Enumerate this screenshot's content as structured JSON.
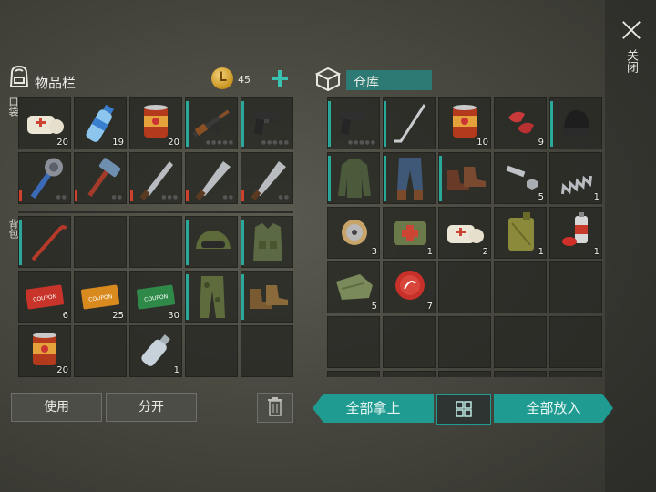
{
  "close": {
    "label": "关闭"
  },
  "inventory": {
    "title": "物品栏",
    "coins": "45",
    "pocket_label": "口袋",
    "backpack_label": "背包",
    "pocket_slots": [
      {
        "icon": "bandage-icon",
        "qty": "20"
      },
      {
        "icon": "water-bottle-icon",
        "qty": "19"
      },
      {
        "icon": "canned-food-icon",
        "qty": "20"
      },
      {
        "icon": "rifle-icon",
        "qty": ""
      },
      {
        "icon": "pistol-icon",
        "qty": ""
      },
      {
        "icon": "spiked-club-icon",
        "qty": ""
      },
      {
        "icon": "hammer-icon",
        "qty": ""
      },
      {
        "icon": "machete-icon",
        "qty": ""
      },
      {
        "icon": "machete-icon",
        "qty": ""
      },
      {
        "icon": "machete-icon",
        "qty": ""
      }
    ],
    "backpack_slots": [
      {
        "icon": "crowbar-icon",
        "qty": ""
      },
      {
        "icon": "empty",
        "qty": ""
      },
      {
        "icon": "empty",
        "qty": ""
      },
      {
        "icon": "helmet-icon",
        "qty": ""
      },
      {
        "icon": "vest-icon",
        "qty": ""
      },
      {
        "icon": "coupon-red-icon",
        "qty": "6"
      },
      {
        "icon": "coupon-orange-icon",
        "qty": "25"
      },
      {
        "icon": "coupon-green-icon",
        "qty": "30"
      },
      {
        "icon": "camo-pants-icon",
        "qty": ""
      },
      {
        "icon": "boots-icon",
        "qty": ""
      },
      {
        "icon": "canned-food-icon",
        "qty": "20"
      },
      {
        "icon": "empty",
        "qty": ""
      },
      {
        "icon": "bottle-icon",
        "qty": "1"
      },
      {
        "icon": "empty",
        "qty": ""
      },
      {
        "icon": "empty",
        "qty": ""
      }
    ],
    "use_button": "使用",
    "split_button": "分开"
  },
  "storage": {
    "title": "仓库",
    "slots": [
      {
        "icon": "pistol-icon",
        "qty": ""
      },
      {
        "icon": "hockey-stick-icon",
        "qty": ""
      },
      {
        "icon": "canned-food-icon",
        "qty": "10"
      },
      {
        "icon": "meat-icon",
        "qty": "9"
      },
      {
        "icon": "beanie-icon",
        "qty": ""
      },
      {
        "icon": "jacket-icon",
        "qty": ""
      },
      {
        "icon": "jeans-icon",
        "qty": ""
      },
      {
        "icon": "boots-icon",
        "qty": ""
      },
      {
        "icon": "bolt-nut-icon",
        "qty": "5"
      },
      {
        "icon": "spring-icon",
        "qty": "1"
      },
      {
        "icon": "wire-spool-icon",
        "qty": "3"
      },
      {
        "icon": "medkit-bag-icon",
        "qty": "1"
      },
      {
        "icon": "bandage-icon",
        "qty": "2"
      },
      {
        "icon": "jerrycan-icon",
        "qty": "1"
      },
      {
        "icon": "spray-can-icon",
        "qty": "1"
      },
      {
        "icon": "cloth-icon",
        "qty": "5"
      },
      {
        "icon": "bottle-cap-icon",
        "qty": "7"
      },
      {
        "icon": "empty",
        "qty": ""
      },
      {
        "icon": "empty",
        "qty": ""
      },
      {
        "icon": "empty",
        "qty": ""
      },
      {
        "icon": "empty",
        "qty": ""
      },
      {
        "icon": "empty",
        "qty": ""
      },
      {
        "icon": "empty",
        "qty": ""
      },
      {
        "icon": "empty",
        "qty": ""
      },
      {
        "icon": "empty",
        "qty": ""
      },
      {
        "icon": "empty",
        "qty": ""
      },
      {
        "icon": "empty",
        "qty": ""
      },
      {
        "icon": "empty",
        "qty": ""
      },
      {
        "icon": "empty",
        "qty": ""
      },
      {
        "icon": "empty",
        "qty": ""
      }
    ],
    "take_all_button": "全部拿上",
    "put_all_button": "全部放入"
  },
  "colors": {
    "accent": "#1f9b91",
    "durability": "#2aa89a",
    "damage": "#d0402e"
  }
}
